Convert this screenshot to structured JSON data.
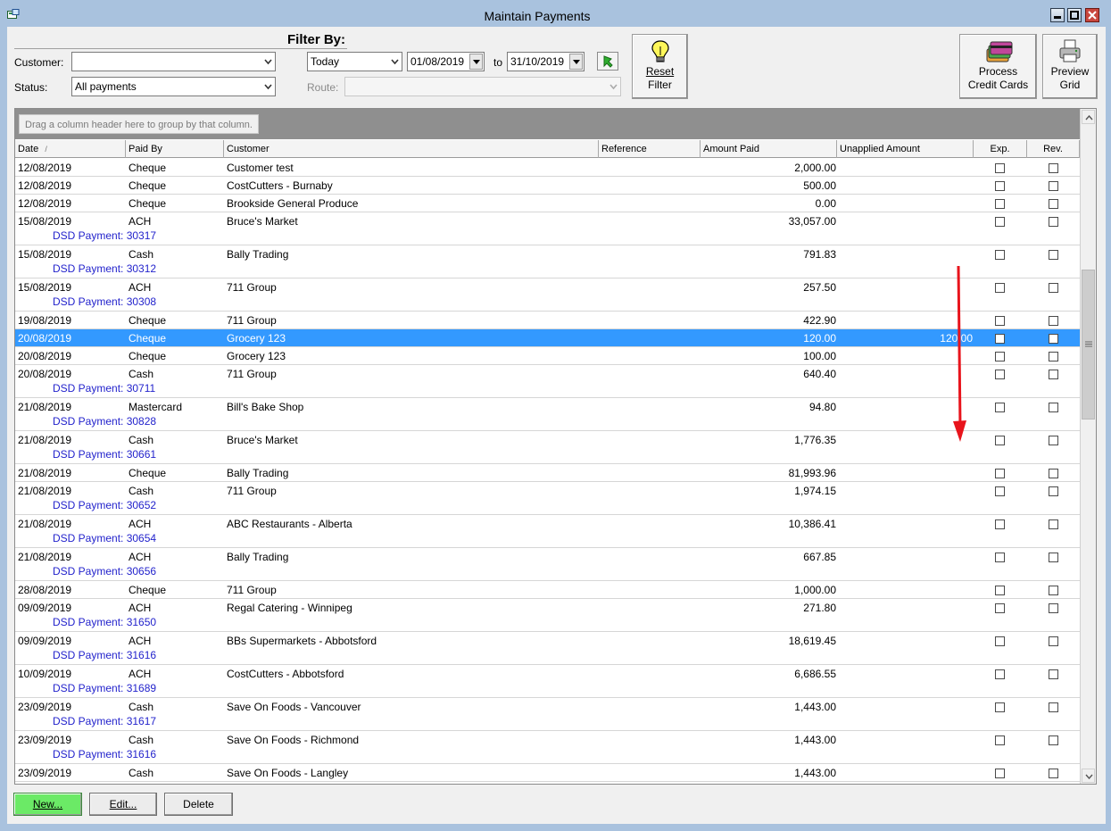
{
  "window": {
    "title": "Maintain Payments"
  },
  "filters": {
    "filter_by_label": "Filter By:",
    "customer_label": "Customer:",
    "customer_value": "",
    "status_label": "Status:",
    "status_value": "All payments",
    "period_value": "Today",
    "date_from": "01/08/2019",
    "to_label": "to",
    "date_to": "31/10/2019",
    "route_label": "Route:",
    "route_value": ""
  },
  "buttons": {
    "reset_filter": [
      "Reset",
      "Filter"
    ],
    "process_credit_cards": [
      "Process",
      "Credit Cards"
    ],
    "preview_grid": [
      "Preview",
      "Grid"
    ],
    "new": "New...",
    "edit": "Edit...",
    "delete": "Delete"
  },
  "grid": {
    "group_hint": "Drag a column header here to group by that column.",
    "columns": [
      "Date",
      "Paid By",
      "Customer",
      "Reference",
      "Amount Paid",
      "Unapplied Amount",
      "Exp.",
      "Rev."
    ],
    "sort_indicator": "/",
    "rows": [
      {
        "date": "12/08/2019",
        "paid_by": "Cheque",
        "customer": "Customer test",
        "reference": "",
        "amount": "2,000.00",
        "unapplied": "",
        "dsd": ""
      },
      {
        "date": "12/08/2019",
        "paid_by": "Cheque",
        "customer": "CostCutters - Burnaby",
        "reference": "",
        "amount": "500.00",
        "unapplied": "",
        "dsd": ""
      },
      {
        "date": "12/08/2019",
        "paid_by": "Cheque",
        "customer": "Brookside General Produce",
        "reference": "",
        "amount": "0.00",
        "unapplied": "",
        "dsd": ""
      },
      {
        "date": "15/08/2019",
        "paid_by": "ACH",
        "customer": "Bruce's Market",
        "reference": "",
        "amount": "33,057.00",
        "unapplied": "",
        "dsd": "DSD Payment: 30317"
      },
      {
        "date": "15/08/2019",
        "paid_by": "Cash",
        "customer": "Bally Trading",
        "reference": "",
        "amount": "791.83",
        "unapplied": "",
        "dsd": "DSD Payment: 30312"
      },
      {
        "date": "15/08/2019",
        "paid_by": "ACH",
        "customer": "711 Group",
        "reference": "",
        "amount": "257.50",
        "unapplied": "",
        "dsd": "DSD Payment: 30308"
      },
      {
        "date": "19/08/2019",
        "paid_by": "Cheque",
        "customer": "711 Group",
        "reference": "",
        "amount": "422.90",
        "unapplied": "",
        "dsd": ""
      },
      {
        "date": "20/08/2019",
        "paid_by": "Cheque",
        "customer": "Grocery 123",
        "reference": "",
        "amount": "120.00",
        "unapplied": "120.00",
        "dsd": "",
        "selected": true
      },
      {
        "date": "20/08/2019",
        "paid_by": "Cheque",
        "customer": "Grocery 123",
        "reference": "",
        "amount": "100.00",
        "unapplied": "",
        "dsd": ""
      },
      {
        "date": "20/08/2019",
        "paid_by": "Cash",
        "customer": "711 Group",
        "reference": "",
        "amount": "640.40",
        "unapplied": "",
        "dsd": "DSD Payment: 30711"
      },
      {
        "date": "21/08/2019",
        "paid_by": "Mastercard",
        "customer": "Bill's Bake Shop",
        "reference": "",
        "amount": "94.80",
        "unapplied": "",
        "dsd": "DSD Payment: 30828"
      },
      {
        "date": "21/08/2019",
        "paid_by": "Cash",
        "customer": "Bruce's Market",
        "reference": "",
        "amount": "1,776.35",
        "unapplied": "",
        "dsd": "DSD Payment: 30661"
      },
      {
        "date": "21/08/2019",
        "paid_by": "Cheque",
        "customer": "Bally Trading",
        "reference": "",
        "amount": "81,993.96",
        "unapplied": "",
        "dsd": ""
      },
      {
        "date": "21/08/2019",
        "paid_by": "Cash",
        "customer": "711 Group",
        "reference": "",
        "amount": "1,974.15",
        "unapplied": "",
        "dsd": "DSD Payment: 30652"
      },
      {
        "date": "21/08/2019",
        "paid_by": "ACH",
        "customer": "ABC Restaurants - Alberta",
        "reference": "",
        "amount": "10,386.41",
        "unapplied": "",
        "dsd": "DSD Payment: 30654"
      },
      {
        "date": "21/08/2019",
        "paid_by": "ACH",
        "customer": "Bally Trading",
        "reference": "",
        "amount": "667.85",
        "unapplied": "",
        "dsd": "DSD Payment: 30656"
      },
      {
        "date": "28/08/2019",
        "paid_by": "Cheque",
        "customer": "711 Group",
        "reference": "",
        "amount": "1,000.00",
        "unapplied": "",
        "dsd": ""
      },
      {
        "date": "09/09/2019",
        "paid_by": "ACH",
        "customer": "Regal Catering - Winnipeg",
        "reference": "",
        "amount": "271.80",
        "unapplied": "",
        "dsd": "DSD Payment: 31650"
      },
      {
        "date": "09/09/2019",
        "paid_by": "ACH",
        "customer": "BBs Supermarkets - Abbotsford",
        "reference": "",
        "amount": "18,619.45",
        "unapplied": "",
        "dsd": "DSD Payment: 31616"
      },
      {
        "date": "10/09/2019",
        "paid_by": "ACH",
        "customer": "CostCutters - Abbotsford",
        "reference": "",
        "amount": "6,686.55",
        "unapplied": "",
        "dsd": "DSD Payment: 31689"
      },
      {
        "date": "23/09/2019",
        "paid_by": "Cash",
        "customer": "Save On Foods - Vancouver",
        "reference": "",
        "amount": "1,443.00",
        "unapplied": "",
        "dsd": "DSD Payment: 31617"
      },
      {
        "date": "23/09/2019",
        "paid_by": "Cash",
        "customer": "Save On Foods - Richmond",
        "reference": "",
        "amount": "1,443.00",
        "unapplied": "",
        "dsd": "DSD Payment: 31616"
      },
      {
        "date": "23/09/2019",
        "paid_by": "Cash",
        "customer": "Save On Foods - Langley",
        "reference": "",
        "amount": "1,443.00",
        "unapplied": "",
        "dsd": ""
      }
    ]
  },
  "colors": {
    "selection": "#3399ff",
    "dsd_text": "#2323cc",
    "new_button": "#6bea66",
    "annotation_arrow": "#e8141c"
  }
}
